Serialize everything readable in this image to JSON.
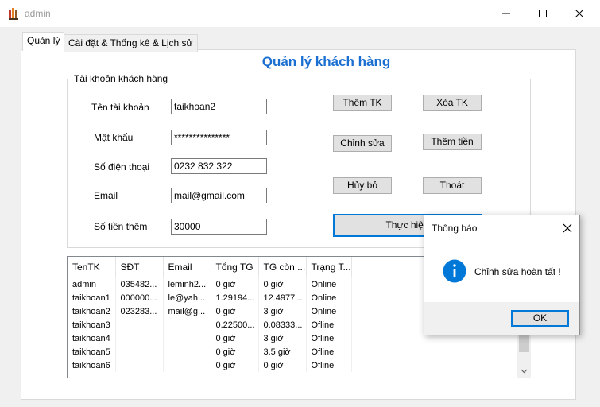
{
  "window": {
    "title": "admin"
  },
  "tabs": [
    {
      "label": "Quản lý"
    },
    {
      "label": "Cài đặt & Thống kê & Lịch sử"
    }
  ],
  "page_title": "Quản lý khách hàng",
  "account_group": {
    "title": "Tài khoản khách hàng",
    "fields": {
      "account_name": {
        "label": "Tên tài khoản",
        "value": "taikhoan2"
      },
      "password": {
        "label": "Mật khẩu",
        "value": "***************"
      },
      "phone": {
        "label": "Số điện thoại",
        "value": "0232 832 322"
      },
      "email": {
        "label": "Email",
        "value": "mail@gmail.com"
      },
      "amount": {
        "label": "Số tiền thêm",
        "value": "30000"
      }
    },
    "buttons": {
      "add_account": "Thêm TK",
      "delete_account": "Xóa TK",
      "edit": "Chỉnh sửa",
      "add_money": "Thêm tiền",
      "cancel": "Hủy bỏ",
      "exit": "Thoát",
      "execute": "Thực hiện"
    }
  },
  "grid": {
    "columns": [
      "TenTK",
      "SĐT",
      "Email",
      "Tổng TG",
      "TG còn ...",
      "Trạng T..."
    ],
    "rows": [
      [
        "admin",
        "035482...",
        "leminh2...",
        "0 giờ",
        "0 giờ",
        "Online"
      ],
      [
        "taikhoan1",
        "000000...",
        "le@yah...",
        "1.29194...",
        "12.4977...",
        "Online"
      ],
      [
        "taikhoan2",
        "023283...",
        "mail@g...",
        "0 giờ",
        "3 giờ",
        "Online"
      ],
      [
        "taikhoan3",
        "",
        "",
        "0.22500...",
        "0.08333...",
        "Ofline"
      ],
      [
        "taikhoan4",
        "",
        "",
        "0 giờ",
        "3 giờ",
        "Ofline"
      ],
      [
        "taikhoan5",
        "",
        "",
        "0 giờ",
        "3.5 giờ",
        "Ofline"
      ],
      [
        "taikhoan6",
        "",
        "",
        "0 giờ",
        "0 giờ",
        "Ofline"
      ]
    ]
  },
  "dialog": {
    "title": "Thông báo",
    "message": "Chỉnh sửa hoàn tất !",
    "ok_label": "OK"
  },
  "colors": {
    "title_blue": "#1a6fd1",
    "info_blue": "#0078d7",
    "focus_blue": "#0078d7"
  }
}
